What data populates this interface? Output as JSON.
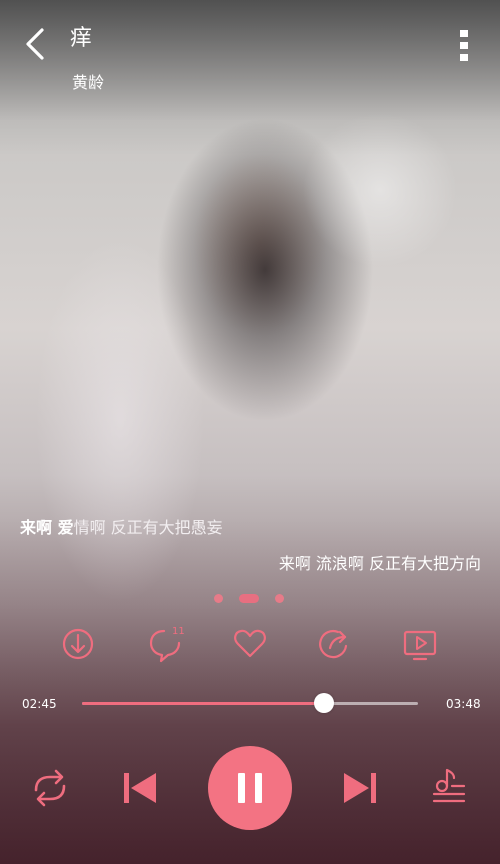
{
  "song": {
    "title": "痒",
    "artist": "黄龄"
  },
  "lyrics": {
    "current_highlight": "来啊 爱",
    "current_rest": "情啊 反正有大把愚妄",
    "next": "来啊 流浪啊 反正有大把方向"
  },
  "pager": {
    "pages": 3,
    "active": 1
  },
  "actions": [
    {
      "name": "download-icon"
    },
    {
      "name": "comment-icon",
      "badge": "11"
    },
    {
      "name": "heart-icon"
    },
    {
      "name": "share-icon"
    },
    {
      "name": "video-icon"
    }
  ],
  "playback": {
    "elapsed": "02:45",
    "duration": "03:48",
    "progress": 0.72,
    "state": "playing"
  },
  "controls": {
    "repeat_icon": "repeat-icon",
    "prev_icon": "previous-icon",
    "play_icon": "pause-icon",
    "next_icon": "next-icon",
    "playlist_icon": "playlist-icon"
  },
  "colors": {
    "accent": "#ef6d7f",
    "play_button": "#f37383",
    "text": "#ffffff"
  }
}
